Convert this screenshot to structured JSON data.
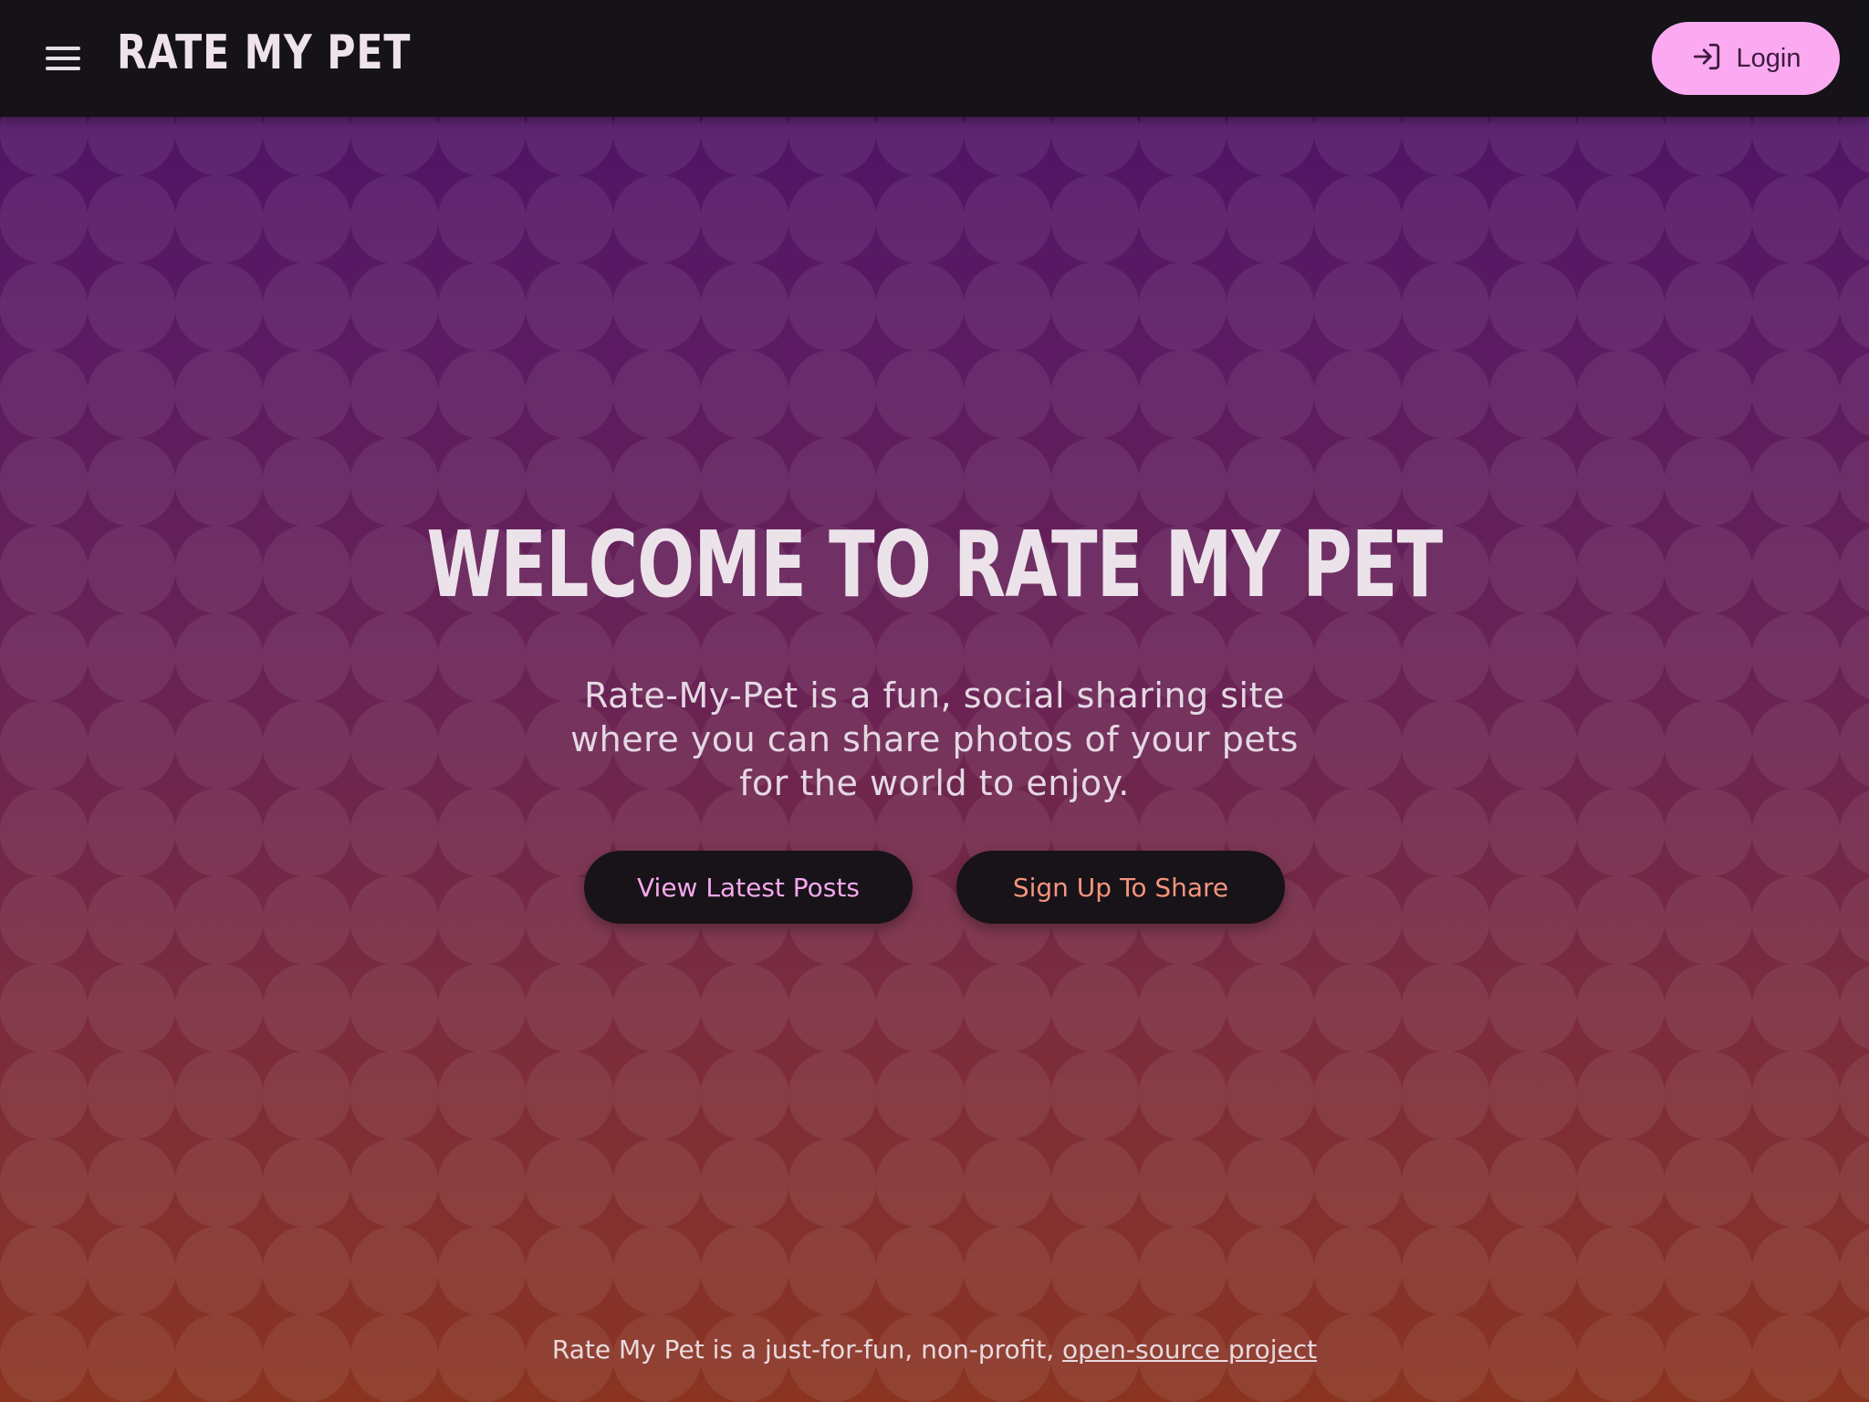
{
  "header": {
    "brand": "RATE MY PET",
    "login_label": "Login"
  },
  "hero": {
    "title": "WELCOME TO RATE MY PET",
    "description": "Rate-My-Pet is a fun, social sharing site where you can share photos of your pets for the world to enjoy.",
    "view_posts_label": "View Latest Posts",
    "signup_label": "Sign Up To Share"
  },
  "footer": {
    "text": "Rate My Pet is a just-for-fun, non-profit, ",
    "link_text": "open-source project"
  },
  "icons": {
    "menu": "hamburger-menu-icon",
    "login": "login-icon"
  },
  "colors": {
    "topbar": "#151218",
    "login_button": "#fbaaf2",
    "cta_background": "#171318",
    "cta_latest_text": "#f6a8ee",
    "cta_signup_text": "#f4947d",
    "gradient_top": "#4a1068",
    "gradient_bottom": "#8a3420"
  }
}
